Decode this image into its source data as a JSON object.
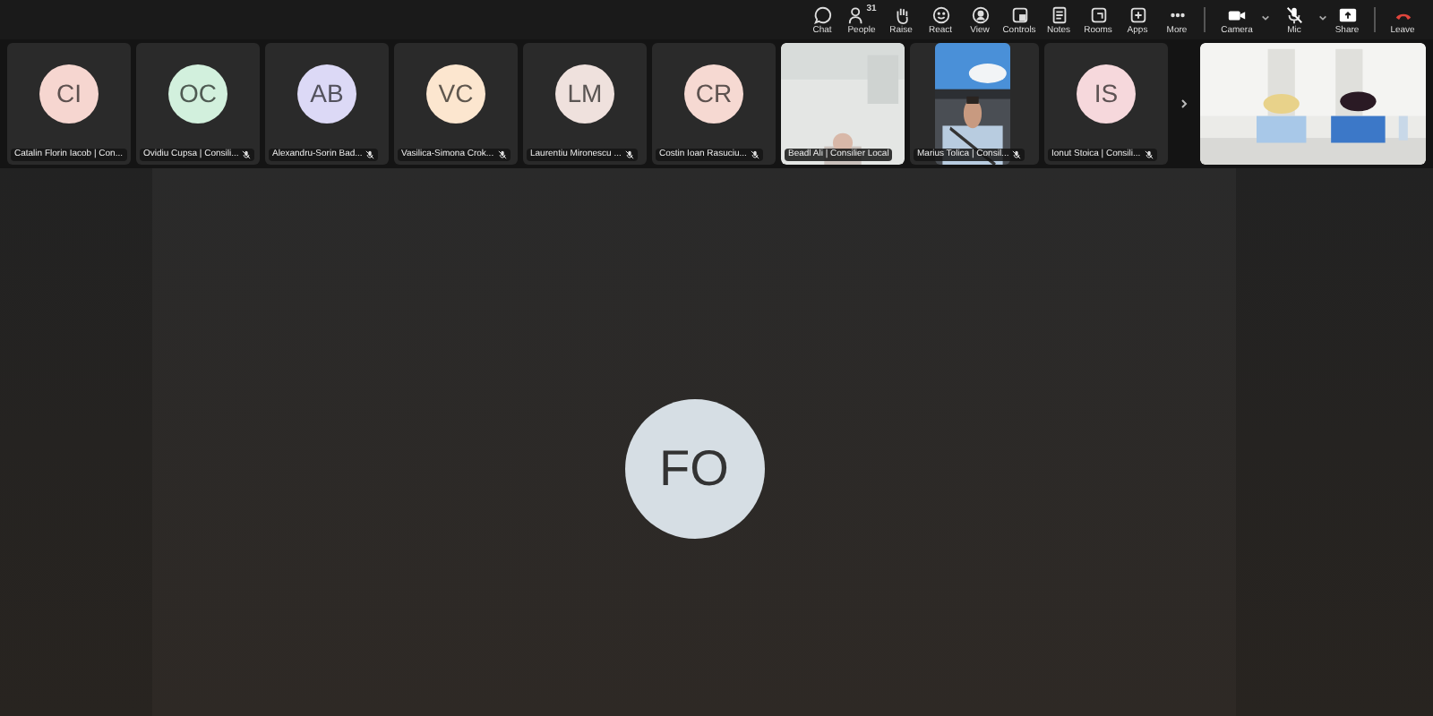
{
  "toolbar": [
    {
      "kind": "chat",
      "label": "Chat"
    },
    {
      "kind": "people",
      "label": "People",
      "count": "31"
    },
    {
      "kind": "raise",
      "label": "Raise"
    },
    {
      "kind": "react",
      "label": "React"
    },
    {
      "kind": "view",
      "label": "View"
    },
    {
      "kind": "controls",
      "label": "Controls"
    },
    {
      "kind": "notes",
      "label": "Notes"
    },
    {
      "kind": "rooms",
      "label": "Rooms"
    },
    {
      "kind": "apps",
      "label": "Apps"
    },
    {
      "kind": "more",
      "label": "More"
    },
    {
      "kind": "camera",
      "label": "Camera",
      "muted": false
    },
    {
      "kind": "mic",
      "label": "Mic",
      "muted": true
    },
    {
      "kind": "share",
      "label": "Share"
    },
    {
      "kind": "leave",
      "label": "Leave"
    }
  ],
  "participants": [
    {
      "kind": "avatar",
      "initials": "CI",
      "color": "#f6d6d0",
      "name": "Catalin Florin Iacob | Con...",
      "muted": false
    },
    {
      "kind": "avatar",
      "initials": "OC",
      "color": "#d2f0dd",
      "name": "Ovidiu Cupsa | Consili...",
      "muted": true
    },
    {
      "kind": "avatar",
      "initials": "AB",
      "color": "#dcd9f6",
      "name": "Alexandru-Sorin Bad...",
      "muted": true
    },
    {
      "kind": "avatar",
      "initials": "VC",
      "color": "#fce6cf",
      "name": "Vasilica-Simona Crok...",
      "muted": true
    },
    {
      "kind": "avatar",
      "initials": "LM",
      "color": "#efe1dd",
      "name": "Laurentiu Mironescu ...",
      "muted": true
    },
    {
      "kind": "avatar",
      "initials": "CR",
      "color": "#f6d9d2",
      "name": "Costin Ioan Rasuciu...",
      "muted": true
    },
    {
      "kind": "video",
      "name": "Beadl Ali | Consilier Local",
      "muted": false
    },
    {
      "kind": "portrait",
      "name": "Marius Tolica | Consil...",
      "muted": true
    },
    {
      "kind": "avatar",
      "initials": "IS",
      "color": "#f6d8dc",
      "name": "Ionut Stoica | Consili...",
      "muted": true
    },
    {
      "kind": "video"
    }
  ],
  "stage": {
    "initials": "FO",
    "color": "#d6dee4"
  }
}
